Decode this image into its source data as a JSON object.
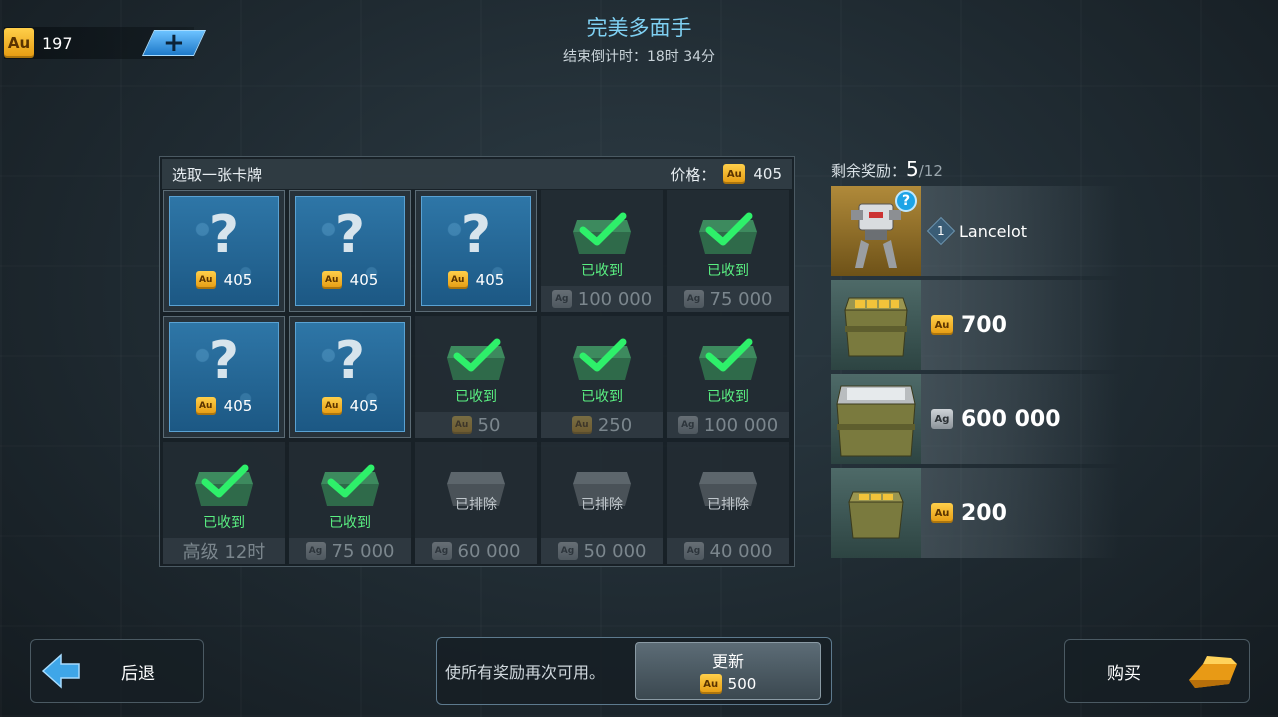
{
  "currency": {
    "gold_amount": "197",
    "gold_icon": "Au"
  },
  "header": {
    "title": "完美多面手",
    "countdown": "结束倒计时：18时 34分"
  },
  "panel": {
    "header_label": "选取一张卡牌",
    "price_label": "价格：",
    "price_value": "405",
    "cells": [
      {
        "state": "hidden",
        "cost": "405"
      },
      {
        "state": "hidden",
        "cost": "405"
      },
      {
        "state": "hidden",
        "cost": "405"
      },
      {
        "state": "got",
        "label": "已收到",
        "currency": "Ag",
        "reward": "100 000"
      },
      {
        "state": "got",
        "label": "已收到",
        "currency": "Ag",
        "reward": "75 000"
      },
      {
        "state": "hidden",
        "cost": "405"
      },
      {
        "state": "hidden",
        "cost": "405"
      },
      {
        "state": "got",
        "label": "已收到",
        "currency": "Au",
        "reward": "50"
      },
      {
        "state": "got",
        "label": "已收到",
        "currency": "Au",
        "reward": "250"
      },
      {
        "state": "got",
        "label": "已收到",
        "currency": "Ag",
        "reward": "100 000"
      },
      {
        "state": "got",
        "label": "已收到",
        "currency": "",
        "reward": "高级 12时"
      },
      {
        "state": "got",
        "label": "已收到",
        "currency": "Ag",
        "reward": "75 000"
      },
      {
        "state": "out",
        "label": "已排除",
        "currency": "Ag",
        "reward": "60 000"
      },
      {
        "state": "out",
        "label": "已排除",
        "currency": "Ag",
        "reward": "50 000"
      },
      {
        "state": "out",
        "label": "已排除",
        "currency": "Ag",
        "reward": "40 000"
      }
    ]
  },
  "rewards": {
    "remaining_label": "剩余奖励：",
    "remaining_count": "5",
    "remaining_total": "/12",
    "items": [
      {
        "type": "robot",
        "level": "1",
        "name": "Lancelot",
        "help": "?"
      },
      {
        "type": "gold",
        "currency": "Au",
        "amount": "700"
      },
      {
        "type": "silver",
        "currency": "Ag",
        "amount": "600 000"
      },
      {
        "type": "gold",
        "currency": "Au",
        "amount": "200"
      }
    ]
  },
  "footer": {
    "back_label": "后退",
    "refresh_text": "使所有奖励再次可用。",
    "refresh_button": "更新",
    "refresh_cost": "500",
    "buy_label": "购买"
  },
  "colors": {
    "accent_title": "#7fd0f2",
    "received_green": "#5af082",
    "card_blue": "#2e76a7"
  }
}
